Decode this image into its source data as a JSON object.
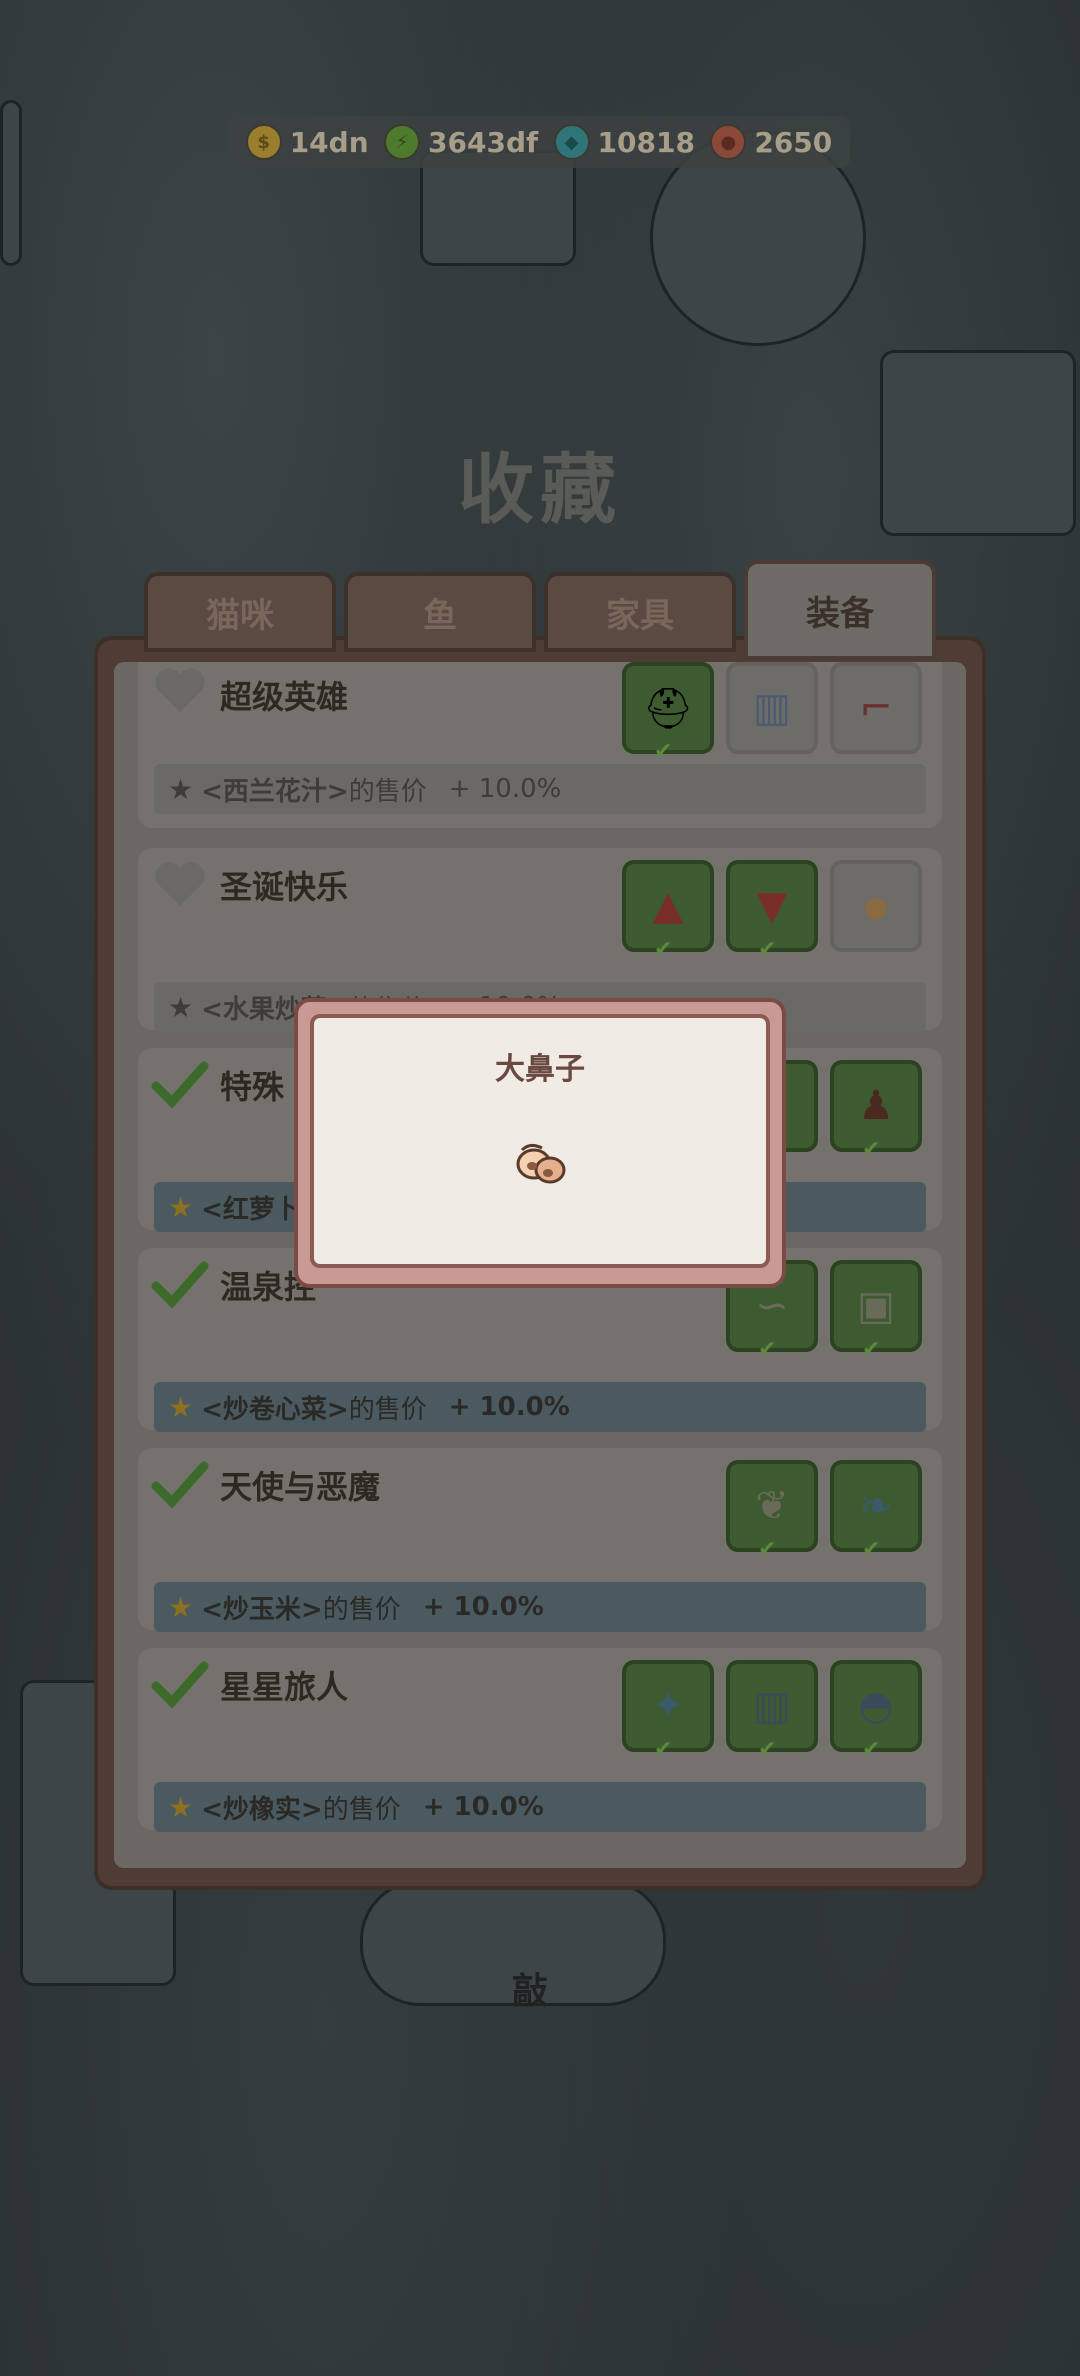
{
  "currency": [
    {
      "icon": "coin-icon",
      "value": "14dn",
      "color": "#c9a23a"
    },
    {
      "icon": "lightning-icon",
      "value": "3643df",
      "color": "#6ca03a"
    },
    {
      "icon": "gem-icon",
      "value": "10818",
      "color": "#3a9aa0"
    },
    {
      "icon": "fish-token-icon",
      "value": "2650",
      "color": "#c0604a"
    }
  ],
  "page_title": "收藏",
  "tabs": [
    {
      "label": "猫咪",
      "active": false
    },
    {
      "label": "鱼",
      "active": false
    },
    {
      "label": "家具",
      "active": false
    },
    {
      "label": "装备",
      "active": true
    }
  ],
  "sets": [
    {
      "name": "超级英雄",
      "completed": false,
      "bonus": {
        "item": "<西兰花汁>",
        "suffix": "的售价",
        "pct": "+ 10.0%"
      },
      "items": [
        {
          "icon": "helmet-icon",
          "owned": true
        },
        {
          "icon": "vest-icon",
          "owned": false
        },
        {
          "icon": "boots-icon",
          "owned": false
        }
      ]
    },
    {
      "name": "圣诞快乐",
      "completed": false,
      "bonus": {
        "item": "<水果炒菜>",
        "suffix": "的售价",
        "pct": "+ 10.0%"
      },
      "items": [
        {
          "icon": "santa-hat-icon",
          "owned": true
        },
        {
          "icon": "santa-coat-icon",
          "owned": true
        },
        {
          "icon": "big-nose-icon",
          "owned": false
        }
      ]
    },
    {
      "name": "特殊",
      "completed": true,
      "bonus": {
        "item": "<红萝卜",
        "suffix": "",
        "pct": ""
      },
      "items": [
        {
          "icon": "box-icon",
          "owned": true
        },
        {
          "icon": "plunger-icon",
          "owned": true
        }
      ]
    },
    {
      "name": "温泉控",
      "completed": true,
      "bonus": {
        "item": "<炒卷心菜>",
        "suffix": "的售价",
        "pct": "+ 10.0%"
      },
      "items": [
        {
          "icon": "towel-icon",
          "owned": true
        },
        {
          "icon": "robe-icon",
          "owned": true
        }
      ]
    },
    {
      "name": "天使与恶魔",
      "completed": true,
      "bonus": {
        "item": "<炒玉米>",
        "suffix": "的售价",
        "pct": "+ 10.0%"
      },
      "items": [
        {
          "icon": "angel-wings-icon",
          "owned": true
        },
        {
          "icon": "demon-wings-icon",
          "owned": true
        }
      ]
    },
    {
      "name": "星星旅人",
      "completed": true,
      "bonus": {
        "item": "<炒橡实>",
        "suffix": "的售价",
        "pct": "+ 10.0%"
      },
      "items": [
        {
          "icon": "star-cap-icon",
          "owned": true
        },
        {
          "icon": "traveler-vest-icon",
          "owned": true
        },
        {
          "icon": "traveler-shoes-icon",
          "owned": true
        }
      ]
    }
  ],
  "popup": {
    "title": "大鼻子",
    "icon": "big-nose-icon"
  },
  "bottom_label": "敲"
}
